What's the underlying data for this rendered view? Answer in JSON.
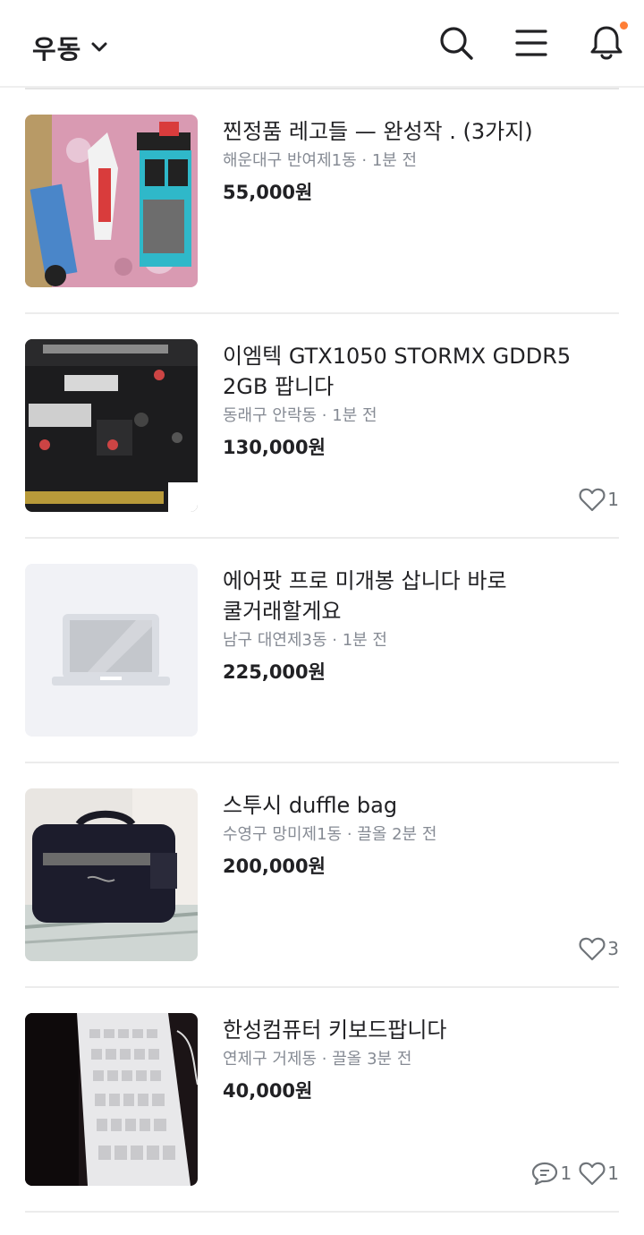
{
  "header": {
    "location": "우동",
    "icons": [
      "chevron-down-icon",
      "search-icon",
      "menu-icon",
      "bell-icon"
    ],
    "notification_dot_color": "#ff7e36"
  },
  "items": [
    {
      "title": "찐정품  레고들 — 완성작  .   (3가지)",
      "meta": "해운대구 반여제1동 · 1분 전",
      "price": "55,000원",
      "likes": "",
      "chats": ""
    },
    {
      "title": "이엠텍 GTX1050 STORMX GDDR5 2GB 팝니다",
      "meta": "동래구 안락동 · 1분 전",
      "price": "130,000원",
      "likes": "1",
      "chats": ""
    },
    {
      "title": "에어팟 프로 미개봉 삽니다 바로 쿨거래할게요",
      "meta": "남구 대연제3동 · 1분 전",
      "price": "225,000원",
      "likes": "",
      "chats": ""
    },
    {
      "title": "스투시 duffle bag",
      "meta": "수영구 망미제1동 · 끌올 2분 전",
      "price": "200,000원",
      "likes": "3",
      "chats": ""
    },
    {
      "title": "한성컴퓨터 키보드팝니다",
      "meta": "연제구 거제동 · 끌올 3분 전",
      "price": "40,000원",
      "likes": "1",
      "chats": "1"
    }
  ]
}
